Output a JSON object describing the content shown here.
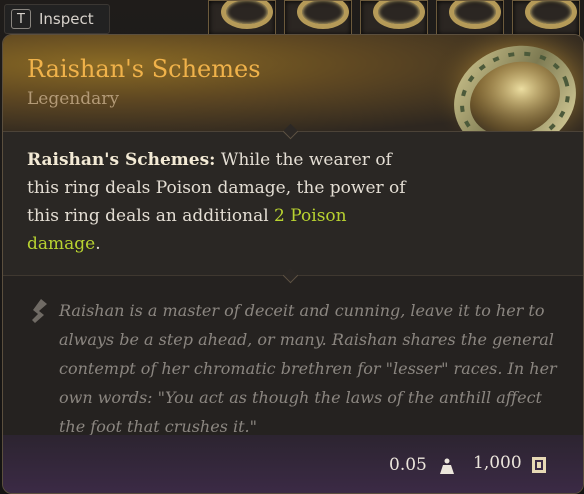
{
  "hotbar": {
    "inspect_key": "T",
    "inspect_label": "Inspect"
  },
  "item": {
    "name": "Raishan's Schemes",
    "rarity": "Legendary",
    "effect_name": "Raishan's Schemes:",
    "effect_text": " While the wearer of this ring deals Poison damage, the power of this ring deals an additional ",
    "effect_damage": "2 Poison damage",
    "effect_end": ".",
    "lore": "Raishan is a master of deceit and cunning, leave it to her to always be a step ahead, or many. Raishan shares the general contempt of her chromatic brethren for \"lesser\" races. In her own words: \"You act as though the laws of the anthill affect the foot that crushes it.\"",
    "weight": "0.05",
    "price": "1,000"
  },
  "colors": {
    "title": "#f0b24a",
    "rarity": "#b39a77",
    "damage": "#b8d230",
    "lore": "#8b8680"
  },
  "icons": {
    "weight": "weight-icon",
    "gold": "gold-coin-icon",
    "lore": "quill-icon"
  }
}
